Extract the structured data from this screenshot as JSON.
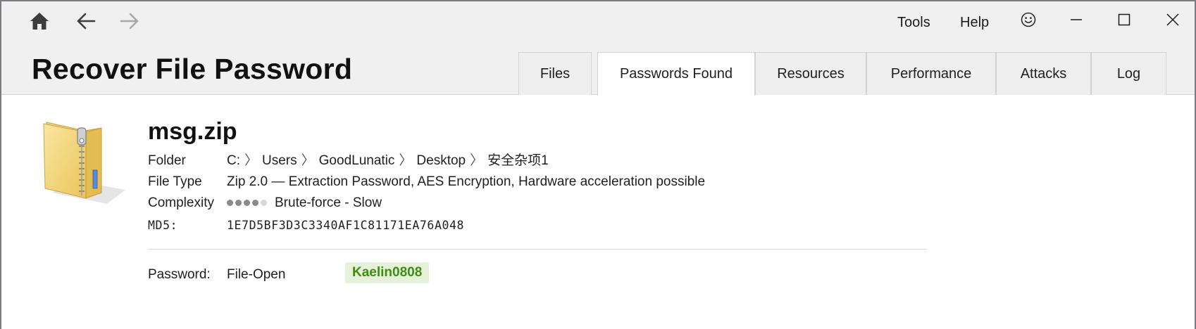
{
  "window": {
    "title": "Recover File Password"
  },
  "nav": {
    "home_icon": "home-icon",
    "back_icon": "arrow-left-icon",
    "forward_icon": "arrow-right-icon"
  },
  "menu": {
    "tools": "Tools",
    "help": "Help",
    "feedback_icon": "smiley-icon"
  },
  "window_controls": {
    "minimize_icon": "minimize-icon",
    "maximize_icon": "maximize-icon",
    "close_icon": "close-icon"
  },
  "tabs": [
    {
      "label": "Files",
      "active": false
    },
    {
      "label": "Passwords Found",
      "active": true
    },
    {
      "label": "Resources",
      "active": false
    },
    {
      "label": "Performance",
      "active": false
    },
    {
      "label": "Attacks",
      "active": false
    },
    {
      "label": "Log",
      "active": false
    }
  ],
  "file": {
    "icon": "zip-folder-icon",
    "name": "msg.zip",
    "folder_label": "Folder",
    "folder_path": [
      "C:",
      "Users",
      "GoodLunatic",
      "Desktop",
      "安全杂项1"
    ],
    "folder_sep": "〉",
    "type_label": "File Type",
    "type_value": "Zip 2.0 — Extraction Password, AES Encryption, Hardware acceleration possible",
    "complexity_label": "Complexity",
    "complexity_level": 4,
    "complexity_max": 5,
    "complexity_value": "Brute-force - Slow",
    "md5_label": "MD5:",
    "md5_value": "1E7D5BF3D3C3340AF1C81171EA76A048"
  },
  "password": {
    "label": "Password:",
    "kind": "File-Open",
    "value": "Kaelin0808"
  },
  "colors": {
    "titlebar_bg": "#f0f0f0",
    "password_badge_bg": "#e6f1da",
    "password_text": "#3e8e12",
    "dot_filled": "#8a8a8a",
    "dot_empty": "#d8d8d8"
  }
}
